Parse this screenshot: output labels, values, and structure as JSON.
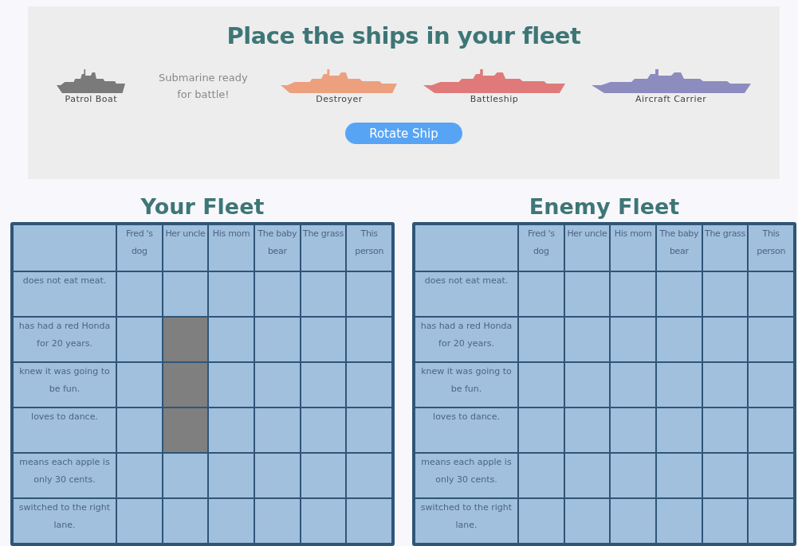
{
  "title": "Place the ships in your fleet",
  "ships": [
    {
      "kind": "ship",
      "label": "Patrol Boat",
      "color": "#7a7a7a"
    },
    {
      "kind": "message",
      "text": "Submarine ready for battle!"
    },
    {
      "kind": "ship",
      "label": "Destroyer",
      "color": "#eda07e"
    },
    {
      "kind": "ship",
      "label": "Battleship",
      "color": "#e07a7a"
    },
    {
      "kind": "ship",
      "label": "Aircraft Carrier",
      "color": "#8c8cbf"
    }
  ],
  "rotate_button": "Rotate Ship",
  "boards": [
    {
      "title": "Your Fleet",
      "columns": [
        "Fred 's dog",
        "Her uncle",
        "His mom",
        "The baby bear",
        "The grass",
        "This person"
      ],
      "rows": [
        {
          "label": "does not eat meat.",
          "cells": [
            false,
            false,
            false,
            false,
            false,
            false
          ]
        },
        {
          "label": "has had a red Honda for 20 years.",
          "cells": [
            false,
            true,
            false,
            false,
            false,
            false
          ]
        },
        {
          "label": "knew it was going to be fun.",
          "cells": [
            false,
            true,
            false,
            false,
            false,
            false
          ]
        },
        {
          "label": "loves to dance.",
          "cells": [
            false,
            true,
            false,
            false,
            false,
            false
          ]
        },
        {
          "label": "means each apple is only 30 cents.",
          "cells": [
            false,
            false,
            false,
            false,
            false,
            false
          ]
        },
        {
          "label": "switched to the right lane.",
          "cells": [
            false,
            false,
            false,
            false,
            false,
            false
          ]
        }
      ]
    },
    {
      "title": "Enemy Fleet",
      "columns": [
        "Fred 's dog",
        "Her uncle",
        "His mom",
        "The baby bear",
        "The grass",
        "This person"
      ],
      "rows": [
        {
          "label": "does not eat meat.",
          "cells": [
            false,
            false,
            false,
            false,
            false,
            false
          ]
        },
        {
          "label": "has had a red Honda for 20 years.",
          "cells": [
            false,
            false,
            false,
            false,
            false,
            false
          ]
        },
        {
          "label": "knew it was going to be fun.",
          "cells": [
            false,
            false,
            false,
            false,
            false,
            false
          ]
        },
        {
          "label": "loves to dance.",
          "cells": [
            false,
            false,
            false,
            false,
            false,
            false
          ]
        },
        {
          "label": "means each apple is only 30 cents.",
          "cells": [
            false,
            false,
            false,
            false,
            false,
            false
          ]
        },
        {
          "label": "switched to the right lane.",
          "cells": [
            false,
            false,
            false,
            false,
            false,
            false
          ]
        }
      ]
    }
  ]
}
